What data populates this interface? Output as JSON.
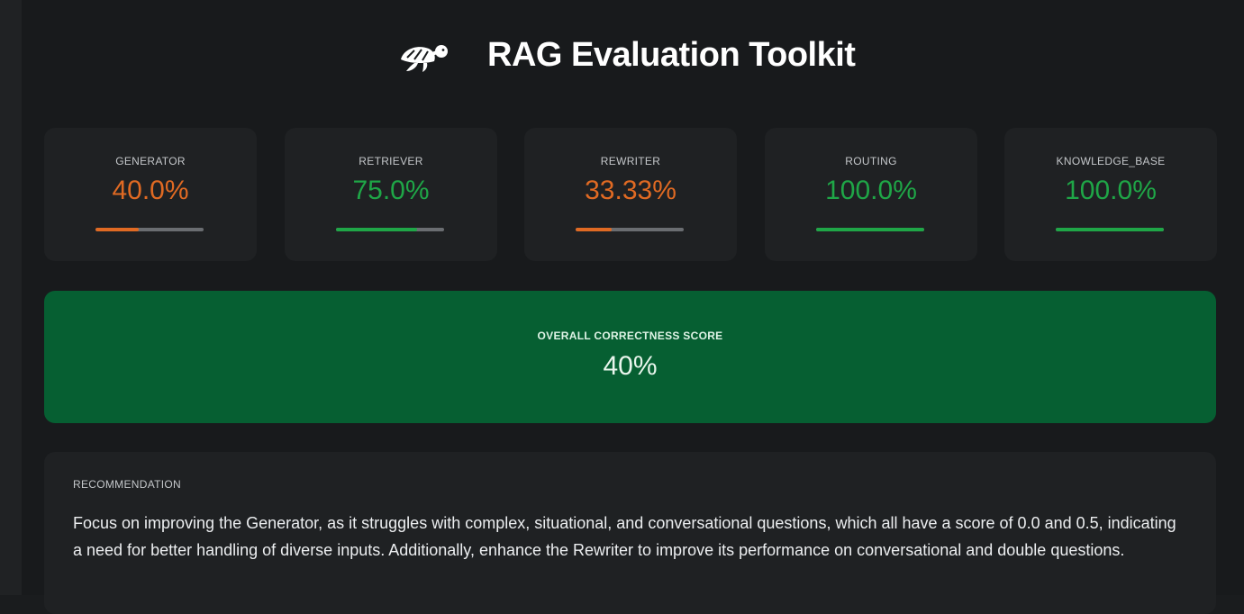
{
  "app": {
    "title": "RAG Evaluation Toolkit",
    "logo_icon": "turtle-icon"
  },
  "colors": {
    "good": "#1fa647",
    "warn": "#e06a23",
    "overall_bg": "#065f32"
  },
  "metrics": [
    {
      "label": "GENERATOR",
      "value": "40.0%",
      "fraction": 0.4,
      "status": "warn"
    },
    {
      "label": "RETRIEVER",
      "value": "75.0%",
      "fraction": 0.75,
      "status": "good"
    },
    {
      "label": "REWRITER",
      "value": "33.33%",
      "fraction": 0.3333,
      "status": "warn"
    },
    {
      "label": "ROUTING",
      "value": "100.0%",
      "fraction": 1.0,
      "status": "good"
    },
    {
      "label": "KNOWLEDGE_BASE",
      "value": "100.0%",
      "fraction": 1.0,
      "status": "good"
    }
  ],
  "overall": {
    "label": "OVERALL CORRECTNESS SCORE",
    "value": "40%"
  },
  "recommendation": {
    "label": "RECOMMENDATION",
    "text": "Focus on improving the Generator, as it struggles with complex, situational, and conversational questions, which all have a score of 0.0 and 0.5, indicating a need for better handling of diverse inputs. Additionally, enhance the Rewriter to improve its performance on conversational and double questions."
  }
}
